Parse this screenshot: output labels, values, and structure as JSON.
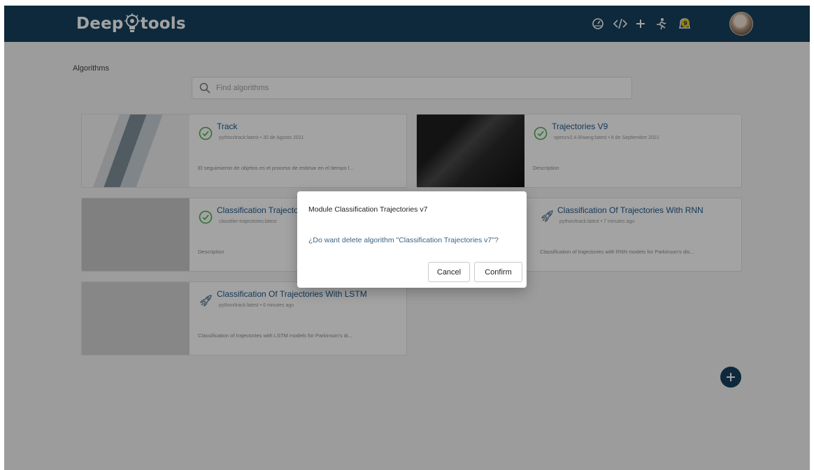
{
  "app": {
    "logo_left": "Deep",
    "logo_right": "tools"
  },
  "topbar": {
    "icons": [
      "dashboard-icon",
      "code-icon",
      "plus-icon",
      "run-icon",
      "notification-icon"
    ],
    "notification_badge": "9"
  },
  "breadcrumb": "Algorithms",
  "search": {
    "placeholder": "Find algorithms",
    "value": ""
  },
  "cards": [
    {
      "title": "Track",
      "meta": "python/track:latest • 30 de Agosto 2021",
      "description": "El seguimiento de objetos es el proceso de estimar en el tiempo l...",
      "status": "ready"
    },
    {
      "title": "Trajectories V9",
      "meta": "opencv2.4.9/wang:latest • 8 de Septiembre 2021",
      "description": "Description",
      "status": "ready"
    },
    {
      "title": "Classification Trajectories v7",
      "meta": "classifier-trajectories:latest",
      "description": "Description",
      "status": "ready"
    },
    {
      "title": "Classification Of Trajectories With RNN",
      "meta": "python/track:latest • 7 minutes ago",
      "description": "Classification of trajectories with RNN models for Parkinson's dis...",
      "status": "building"
    },
    {
      "title": "Classification Of Trajectories With LSTM",
      "meta": "python/track:latest • 6 minutes ago",
      "description": "Classification of trajectories with LSTM models for Parkinson's di...",
      "status": "building"
    }
  ],
  "modal": {
    "title": "Module Classification Trajectories v7",
    "message": "¿Do want delete algorithm \"Classification Trajectories v7\"?",
    "cancel_label": "Cancel",
    "confirm_label": "Confirm"
  },
  "colors": {
    "header": "#16405f",
    "accent": "#4caf50",
    "title_link": "#205a8a",
    "badge": "#f5c518"
  }
}
